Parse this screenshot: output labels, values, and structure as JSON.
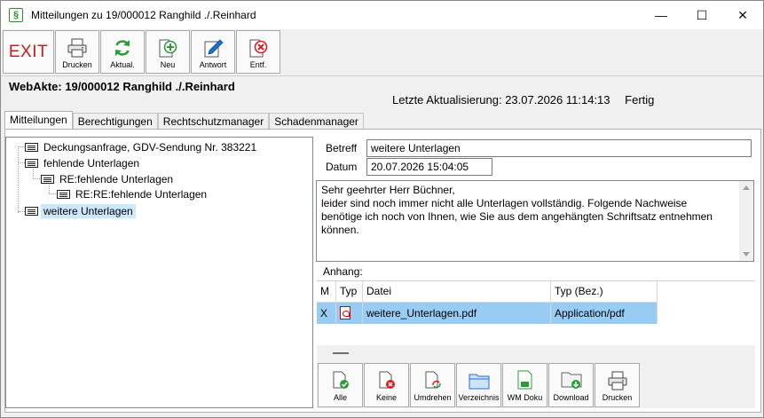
{
  "window": {
    "title": "Mitteilungen zu 19/000012 Ranghild ./.Reinhard",
    "app_icon_glyph": "§",
    "minimize_glyph": "—",
    "maximize_glyph": "☐",
    "close_glyph": "✕"
  },
  "toolbar": {
    "exit_label": "EXIT",
    "buttons": [
      {
        "label": "Drucken",
        "icon": "printer-icon"
      },
      {
        "label": "Aktual.",
        "icon": "refresh-icon"
      },
      {
        "label": "Neu",
        "icon": "new-icon"
      },
      {
        "label": "Antwort",
        "icon": "reply-pen-icon"
      },
      {
        "label": "Entf.",
        "icon": "delete-icon"
      }
    ]
  },
  "header": {
    "webakte": "WebAkte: 19/000012 Ranghild ./.Reinhard",
    "last_update_label": "Letzte Aktualisierung:",
    "last_update_value": "23.07.2026 11:14:13",
    "status": "Fertig"
  },
  "tabs": [
    {
      "label": "Mitteilungen",
      "active": true
    },
    {
      "label": "Berechtigungen",
      "active": false
    },
    {
      "label": "Rechtschutzmanager",
      "active": false
    },
    {
      "label": "Schadenmanager",
      "active": false
    }
  ],
  "tree": [
    {
      "label": "Deckungsanfrage, GDV-Sendung Nr. 383221",
      "level": 0,
      "selected": false
    },
    {
      "label": "fehlende Unterlagen",
      "level": 0,
      "selected": false
    },
    {
      "label": "RE:fehlende Unterlagen",
      "level": 1,
      "selected": false
    },
    {
      "label": "RE:RE:fehlende Unterlagen",
      "level": 2,
      "selected": false
    },
    {
      "label": "weitere Unterlagen",
      "level": 0,
      "selected": true
    }
  ],
  "detail": {
    "betreff_label": "Betreff",
    "betreff_value": "weitere Unterlagen",
    "datum_label": "Datum",
    "datum_value": "20.07.2026 15:04:05",
    "message_lines": [
      "Sehr geehrter Herr Büchner,",
      "leider sind noch immer nicht alle Unterlagen vollständig. Folgende Nachweise",
      "benötige ich noch von Ihnen, wie Sie aus dem angehängten Schriftsatz entnehmen",
      "können."
    ],
    "anhang_label": "Anhang:"
  },
  "attachments": {
    "columns": [
      "M",
      "Typ",
      "Datei",
      "Typ (Bez.)"
    ],
    "rows": [
      {
        "m": "X",
        "typ_icon": "pdf-icon",
        "datei": "weitere_Unterlagen.pdf",
        "typ_bez": "Application/pdf"
      }
    ]
  },
  "attachment_buttons": [
    {
      "label": "Alle",
      "icon": "check-all-icon"
    },
    {
      "label": "Keine",
      "icon": "uncheck-icon"
    },
    {
      "label": "Umdrehen",
      "icon": "invert-icon"
    },
    {
      "label": "Verzeichnis",
      "icon": "folder-icon"
    },
    {
      "label": "WM Doku",
      "icon": "wm-document-icon"
    },
    {
      "label": "Download",
      "icon": "download-folder-icon"
    },
    {
      "label": "Drucken",
      "icon": "printer-icon"
    }
  ],
  "colors": {
    "exit_red": "#d01a1a",
    "selection": "#cce8ff",
    "grid_selection": "#99ccf2",
    "icon_green": "#2e9b3a",
    "icon_red": "#d42222",
    "icon_blue": "#1e6fd0"
  }
}
